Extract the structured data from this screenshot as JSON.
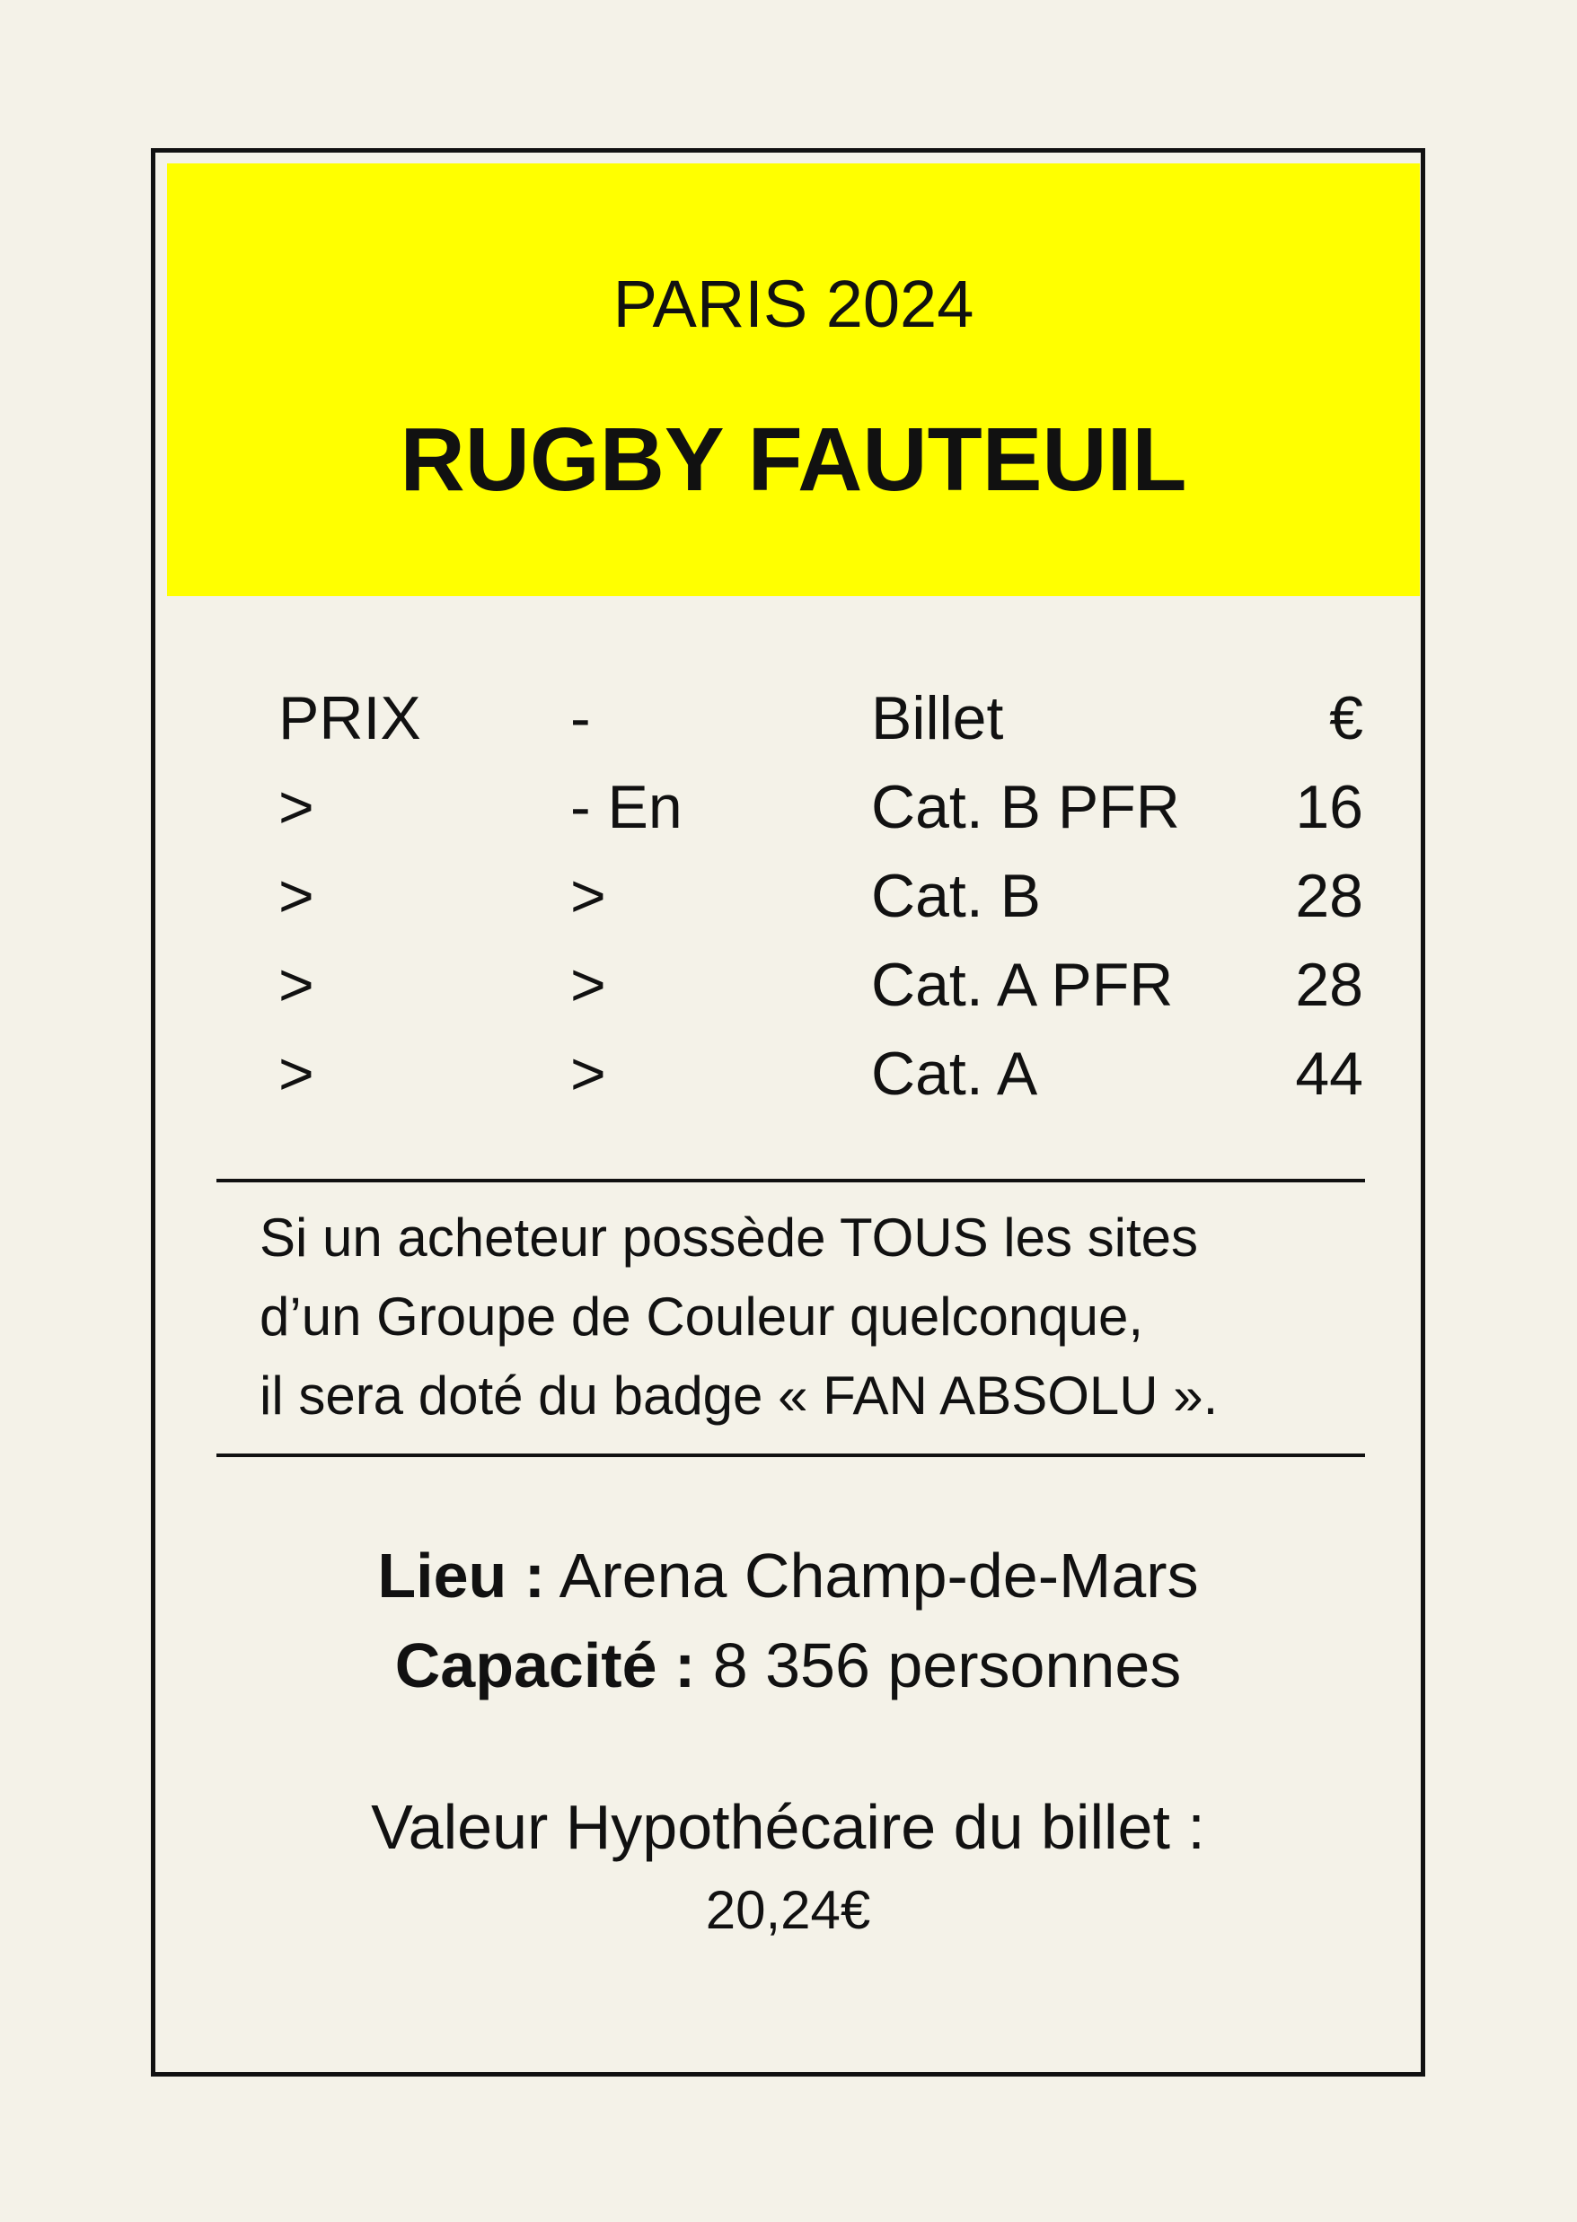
{
  "header": {
    "event_year": "PARIS 2024",
    "event_name": "RUGBY FAUTEUIL",
    "background_color": "#ffff00"
  },
  "price_table": {
    "rows": [
      [
        "PRIX",
        "-",
        "Billet",
        "€"
      ],
      [
        ">",
        "- En",
        "Cat. B PFR",
        "16"
      ],
      [
        ">",
        ">",
        "Cat. B",
        "28"
      ],
      [
        ">",
        ">",
        "Cat. A PFR",
        "28"
      ],
      [
        ">",
        ">",
        "Cat. A",
        "44"
      ]
    ]
  },
  "bonus": {
    "lines": [
      "Si un acheteur possède TOUS les sites",
      "d’un Groupe de Couleur quelconque,",
      "il sera doté du badge « FAN ABSOLU »."
    ]
  },
  "venue": {
    "label": "Lieu :",
    "value": "Arena Champ-de-Mars"
  },
  "capacity": {
    "label": "Capacité :",
    "value": "8 356 personnes"
  },
  "mortgage": {
    "label": "Valeur Hypothécaire du billet :",
    "value": "20,24€"
  }
}
